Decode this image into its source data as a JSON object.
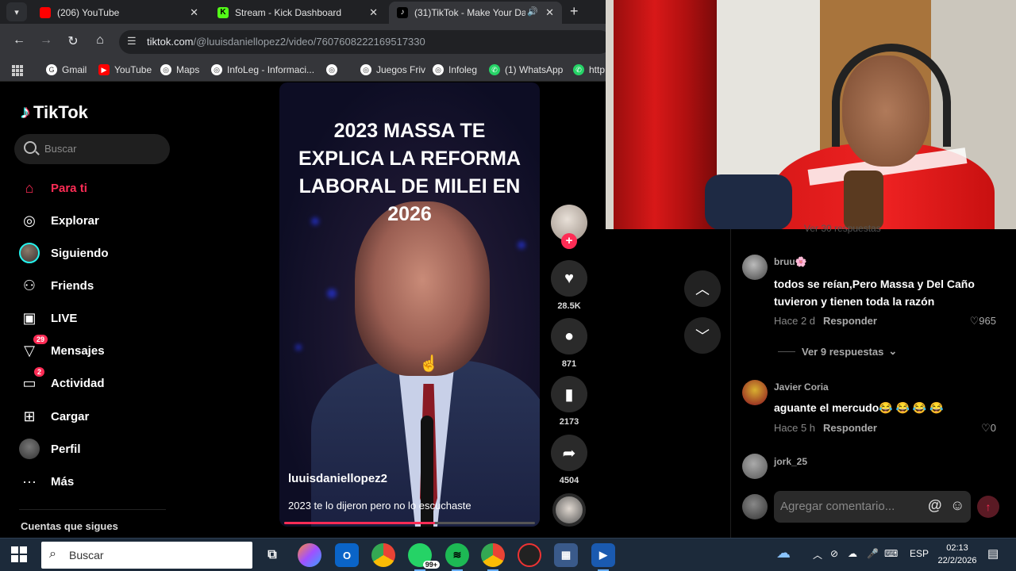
{
  "browser": {
    "tabs": [
      {
        "title": "(206) YouTube",
        "favicon_color": "#ff0000"
      },
      {
        "title": "Stream - Kick Dashboard",
        "favicon_color": "#53fc18"
      },
      {
        "title": "(31)TikTok - Make Your Day",
        "favicon_color": "#000000",
        "active": true
      }
    ],
    "url_host": "tiktok.com",
    "url_path": "/@luuisdaniellopez2/video/7607608222169517330",
    "bookmarks": [
      "Gmail",
      "YouTube",
      "Maps",
      "InfoLeg - Informaci...",
      "",
      "Juegos Friv",
      "Infoleg",
      "(1) WhatsApp",
      "http"
    ]
  },
  "tiktok": {
    "logo_text": "TikTok",
    "search_placeholder": "Buscar",
    "nav": [
      {
        "label": "Para ti",
        "icon": "home-icon",
        "active": true
      },
      {
        "label": "Explorar",
        "icon": "compass-icon"
      },
      {
        "label": "Siguiendo",
        "icon": "following-avatar"
      },
      {
        "label": "Friends",
        "icon": "friends-icon"
      },
      {
        "label": "LIVE",
        "icon": "live-icon"
      },
      {
        "label": "Mensajes",
        "icon": "messages-icon",
        "badge": "29"
      },
      {
        "label": "Actividad",
        "icon": "activity-icon",
        "badge": "2"
      },
      {
        "label": "Cargar",
        "icon": "upload-icon"
      },
      {
        "label": "Perfil",
        "icon": "profile-avatar"
      },
      {
        "label": "Más",
        "icon": "more-icon"
      }
    ],
    "following_title": "Cuentas que sigues",
    "video": {
      "overlay_title": "2023 MASSA TE EXPLICA LA REFORMA LABORAL DE MILEI EN 2026",
      "author": "luuisdaniellopez2",
      "caption": "2023 te lo dijeron pero no lo escuchaste",
      "progress": 0.6
    },
    "actions": {
      "likes": "28.5K",
      "comments": "871",
      "saves": "2173",
      "shares": "4504"
    }
  },
  "comments": {
    "cut_text": "Ver 30 respuestas",
    "items": [
      {
        "user": "bruu🌸",
        "text": "todos se reían,Pero Massa y Del Caño tuvieron y tienen toda la razón",
        "time": "Hace 2 d",
        "reply": "Responder",
        "likes": "965"
      },
      {
        "user": "Javier Coria",
        "text": "aguante el mercudo😂 😂 😂 😂",
        "time": "Hace 5 h",
        "reply": "Responder",
        "likes": "0"
      },
      {
        "user": "jork_25",
        "text": "",
        "time": "",
        "reply": "",
        "likes": ""
      }
    ],
    "view_replies": "Ver 9 respuestas",
    "input_placeholder": "Agregar comentario..."
  },
  "taskbar": {
    "search_placeholder": "Buscar",
    "whatsapp_badge": "99+",
    "lang": "ESP",
    "time": "02:13",
    "date": "22/2/2026",
    "notif_count": "4"
  }
}
